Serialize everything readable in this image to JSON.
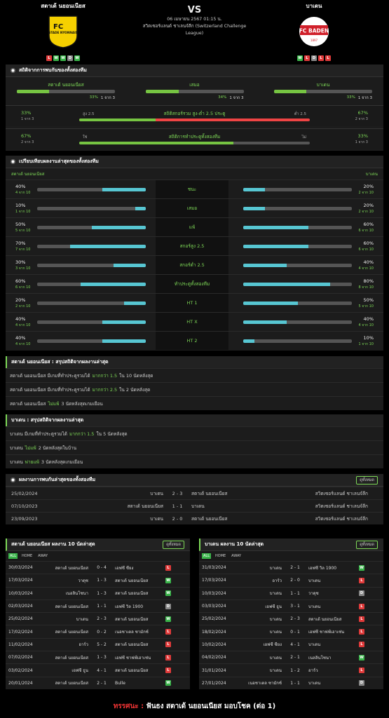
{
  "header": {
    "home": {
      "name": "สตาเด้ นยอนเนียส",
      "crest_text": "STADE NYONNAIS",
      "crest_initials": "FC",
      "form": [
        "L",
        "W",
        "W",
        "D",
        "W"
      ]
    },
    "away": {
      "name": "บาเดน",
      "crest_text": "FC BADEN",
      "crest_year": "1897",
      "form": [
        "W",
        "L",
        "D",
        "L",
        "L"
      ]
    },
    "vs": "VS",
    "date": "06 เมษายน 2567 01:15 น.",
    "league": "สวิตเซอร์แลนด์ ชาเลนจ์ลีก (Switzerland Challenge League)"
  },
  "colors": {
    "accent": "#7ed957",
    "win": "#3ab44a",
    "loss": "#e03a3a",
    "draw": "#888888",
    "teal": "#57c6d2"
  },
  "h2h_stats": {
    "title": "สถิติจากการพบกันของทั้งสองทีม",
    "items": [
      {
        "label": "สตาเด้ นยอนเนียส",
        "pct": "33%",
        "sub": "1 จาก 3",
        "value": 33
      },
      {
        "label": "เสมอ",
        "pct": "34%",
        "sub": "1 จาก 3",
        "value": 34
      },
      {
        "label": "บาเดน",
        "pct": "33%",
        "sub": "1 จาก 3",
        "value": 33
      }
    ],
    "ou": {
      "lp": "33%",
      "ls": "1 จาก 3",
      "rp": "67%",
      "rs": "2 จาก 3",
      "a": "สูง 2.5",
      "b": "ต่ำ 2.5",
      "title": "สถิติสกอร์รวม สูง-ต่ำ 2.5 ประตู",
      "value": 33
    },
    "btts": {
      "lp": "67%",
      "ls": "2 จาก 3",
      "rp": "33%",
      "rs": "1 จาก 3",
      "a": "ใช่",
      "b": "ไม่",
      "title": "สถิติการทำประตูทั้งสองทีม",
      "value": 67
    }
  },
  "compare": {
    "title": "เปรียบเทียบผลงานล่าสุดของทั้งสองทีม",
    "left_team": "สตาเด้ นยอนเนียส",
    "right_team": "บาเดน",
    "rows": [
      {
        "label": "ชนะ",
        "lp": "40%",
        "ls": "4 จาก 10",
        "lv": 40,
        "rp": "20%",
        "rs": "2 จาก 10",
        "rv": 20
      },
      {
        "label": "เสมอ",
        "lp": "10%",
        "ls": "1 จาก 10",
        "lv": 10,
        "rp": "20%",
        "rs": "2 จาก 10",
        "rv": 20
      },
      {
        "label": "แพ้",
        "lp": "50%",
        "ls": "5 จาก 10",
        "lv": 50,
        "rp": "60%",
        "rs": "6 จาก 10",
        "rv": 60
      },
      {
        "label": "สกอร์สูง 2.5",
        "lp": "70%",
        "ls": "7 จาก 10",
        "lv": 70,
        "rp": "60%",
        "rs": "6 จาก 10",
        "rv": 60
      },
      {
        "label": "สกอร์ต่ำ 2.5",
        "lp": "30%",
        "ls": "3 จาก 10",
        "lv": 30,
        "rp": "40%",
        "rs": "4 จาก 10",
        "rv": 40
      },
      {
        "label": "ทำประตูทั้งสองทีม",
        "lp": "60%",
        "ls": "6 จาก 10",
        "lv": 60,
        "rp": "80%",
        "rs": "8 จาก 10",
        "rv": 80
      },
      {
        "label": "HT 1",
        "lp": "20%",
        "ls": "2 จาก 10",
        "lv": 20,
        "rp": "50%",
        "rs": "5 จาก 10",
        "rv": 50
      },
      {
        "label": "HT X",
        "lp": "40%",
        "ls": "4 จาก 10",
        "lv": 40,
        "rp": "40%",
        "rs": "4 จาก 10",
        "rv": 40
      },
      {
        "label": "HT 2",
        "lp": "40%",
        "ls": "4 จาก 10",
        "lv": 40,
        "rp": "10%",
        "rs": "1 จาก 10",
        "rv": 10
      }
    ]
  },
  "summary_home": {
    "title": "สตาเด้ นยอนเนียส : สรุปสถิติจากผลงานล่าสุด",
    "lines": [
      {
        "a": "สตาเด้ นยอนเนียส มีเกมที่ทำประตูรวมได้",
        "b": "มากกว่า 1.5",
        "c": "ใน 10 นัดหลังสุด"
      },
      {
        "a": "สตาเด้ นยอนเนียส มีเกมที่ทำประตูรวมได้",
        "b": "มากกว่า 2.5",
        "c": "ใน 2 นัดหลังสุด"
      },
      {
        "a": "สตาเด้ นยอนเนียส",
        "b": "ไม่แพ้",
        "c": "3 นัดหลังสุดเกมเยือน"
      }
    ]
  },
  "summary_away": {
    "title": "บาเดน : สรุปสถิติจากผลงานล่าสุด",
    "lines": [
      {
        "a": "บาเดน มีเกมที่ทำประตูรวมได้",
        "b": "มากกว่า 1.5",
        "c": "ใน 5 นัดหลังสุด"
      },
      {
        "a": "บาเดน",
        "b": "ไม่แพ้",
        "c": "2 นัดหลังสุดในบ้าน"
      },
      {
        "a": "บาเดน",
        "b": "พ่ายแพ้",
        "c": "3 นัดหลังสุดเกมเยือน"
      }
    ]
  },
  "h2h_results": {
    "title": "ผลงานการพบกันล่าสุดของทั้งสองทีม",
    "button": "ดูทั้งหมด",
    "rows": [
      {
        "date": "25/02/2024",
        "home": "บาเดน",
        "score": "2 - 3",
        "away": "สตาเด้ นยอนเนียส",
        "league": "สวิตเซอร์แลนด์ ชาเลนจ์ลีก"
      },
      {
        "date": "07/10/2023",
        "home": "สตาเด้ นยอนเนียส",
        "score": "1 - 1",
        "away": "บาเดน",
        "league": "สวิตเซอร์แลนด์ ชาเลนจ์ลีก"
      },
      {
        "date": "23/09/2023",
        "home": "บาเดน",
        "score": "2 - 0",
        "away": "สตาเด้ นยอนเนียส",
        "league": "สวิตเซอร์แลนด์ ชาเลนจ์ลีก"
      }
    ]
  },
  "last10_home": {
    "title": "สตาเด้ นยอนเนียส ผลงาน 10 นัดล่าสุด",
    "button": "ดูทั้งหมด",
    "tabs": [
      "ALL",
      "HOME",
      "AWAY"
    ],
    "rows": [
      {
        "date": "30/03/2024",
        "home": "สตาเด้ นยอนเนียส",
        "score": "0 - 4",
        "away": "เอฟซี ซียง",
        "res": "L"
      },
      {
        "date": "17/03/2024",
        "home": "วาดุซ",
        "score": "1 - 3",
        "away": "สตาเด้ นยอนเนียส",
        "res": "W"
      },
      {
        "date": "10/03/2024",
        "home": "เนอลินโซนา",
        "score": "1 - 3",
        "away": "สตาเด้ นยอนเนียส",
        "res": "W"
      },
      {
        "date": "02/03/2024",
        "home": "สตาเด้ นยอนเนียส",
        "score": "1 - 1",
        "away": "เอฟซี วิล 1900",
        "res": "D"
      },
      {
        "date": "25/02/2024",
        "home": "บาเดน",
        "score": "2 - 3",
        "away": "สตาเด้ นยอนเนียส",
        "res": "W"
      },
      {
        "date": "17/02/2024",
        "home": "สตาเด้ นยอนเนียส",
        "score": "0 - 2",
        "away": "เนอชาเตล ซามักซ์",
        "res": "L"
      },
      {
        "date": "11/02/2024",
        "home": "อาร์ว",
        "score": "5 - 2",
        "away": "สตาเด้ นยอนเนียส",
        "res": "L"
      },
      {
        "date": "07/02/2024",
        "home": "สตาเด้ นยอนเนียส",
        "score": "1 - 3",
        "away": "เอฟซี ชาฟฟ์เฮาเซ่น",
        "res": "L"
      },
      {
        "date": "03/02/2024",
        "home": "เอฟซี ธูน",
        "score": "4 - 1",
        "away": "สตาเด้ นยอนเนียส",
        "res": "L"
      },
      {
        "date": "20/01/2024",
        "home": "สตาเด้ นยอนเนียส",
        "score": "2 - 1",
        "away": "Bulle",
        "res": "W"
      }
    ]
  },
  "last10_away": {
    "title": "บาเดน ผลงาน 10 นัดล่าสุด",
    "button": "ดูทั้งหมด",
    "tabs": [
      "ALL",
      "HOME",
      "AWAY"
    ],
    "rows": [
      {
        "date": "31/03/2024",
        "home": "บาเดน",
        "score": "2 - 1",
        "away": "เอฟซี วิล 1900",
        "res": "W"
      },
      {
        "date": "17/03/2024",
        "home": "อาร์ว",
        "score": "2 - 0",
        "away": "บาเดน",
        "res": "L"
      },
      {
        "date": "10/03/2024",
        "home": "บาเดน",
        "score": "1 - 1",
        "away": "วาดุซ",
        "res": "D"
      },
      {
        "date": "03/03/2024",
        "home": "เอฟซี ธูน",
        "score": "3 - 1",
        "away": "บาเดน",
        "res": "L"
      },
      {
        "date": "25/02/2024",
        "home": "บาเดน",
        "score": "2 - 3",
        "away": "สตาเด้ นยอนเนียส",
        "res": "L"
      },
      {
        "date": "18/02/2024",
        "home": "บาเดน",
        "score": "0 - 1",
        "away": "เอฟซี ชาฟฟ์เฮาเซ่น",
        "res": "L"
      },
      {
        "date": "10/02/2024",
        "home": "เอฟซี ซียง",
        "score": "4 - 1",
        "away": "บาเดน",
        "res": "L"
      },
      {
        "date": "04/02/2024",
        "home": "บาเดน",
        "score": "2 - 1",
        "away": "เนลลินโซนา",
        "res": "W"
      },
      {
        "date": "31/01/2024",
        "home": "บาเดน",
        "score": "1 - 2",
        "away": "อาร์ว",
        "res": "L"
      },
      {
        "date": "27/01/2024",
        "home": "เนอชาเตล ซามักซ์",
        "score": "1 - 1",
        "away": "บาเดน",
        "res": "D"
      }
    ]
  },
  "verdict": {
    "label": "ทรรศนะ :",
    "text": "ฟันธง สตาเด้ นยอนเนียส มอบโชค (ต่อ 1)"
  }
}
